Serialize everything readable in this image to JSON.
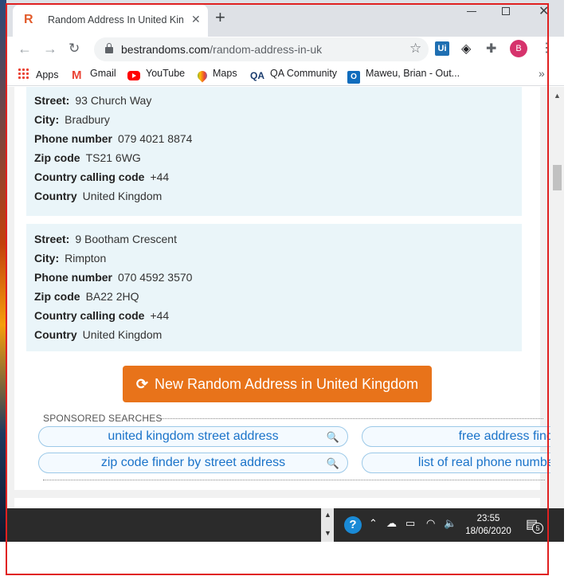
{
  "tab": {
    "favicon": "R",
    "title": "Random Address In United Kingdom",
    "close": "✕",
    "new_tab": "+"
  },
  "window_controls": {
    "minimize": "",
    "maximize": "",
    "close": "✕"
  },
  "toolbar": {
    "back": "←",
    "forward": "→",
    "reload": "↻",
    "url_domain": "bestrandoms.com",
    "url_path": "/random-address-in-uk",
    "star": "☆",
    "ext_ui": "Ui",
    "ext_layers": "◈",
    "ext_puzzle": "✚",
    "avatar": "B",
    "menu": "⋮"
  },
  "bookmarks": {
    "items": [
      "Apps",
      "Gmail",
      "YouTube",
      "Maps",
      "QA Community",
      "Maweu, Brian - Out..."
    ],
    "more": "»"
  },
  "addresses": [
    {
      "street_label": "Street:",
      "street": "93 Church Way",
      "city_label": "City:",
      "city": "Bradbury",
      "phone_label": "Phone number",
      "phone": "079 4021 8874",
      "zip_label": "Zip code",
      "zip": "TS21 6WG",
      "calling_label": "Country calling code",
      "calling": "+44",
      "country_label": "Country",
      "country": "United Kingdom"
    },
    {
      "street_label": "Street:",
      "street": "9 Bootham Crescent",
      "city_label": "City:",
      "city": "Rimpton",
      "phone_label": "Phone number",
      "phone": "070 4592 3570",
      "zip_label": "Zip code",
      "zip": "BA22 2HQ",
      "calling_label": "Country calling code",
      "calling": "+44",
      "country_label": "Country",
      "country": "United Kingdom"
    }
  ],
  "cta": {
    "icon": "⟳",
    "label": "New Random Address in United Kingdom"
  },
  "sponsored": {
    "heading": "SPONSORED SEARCHES",
    "items": [
      "united kingdom street address",
      "free address finder",
      "zip code finder by street address",
      "list of real phone numbers"
    ]
  },
  "taskbar": {
    "help": "?",
    "tray_up": "⌃",
    "tray_cloud": "☁",
    "tray_battery": "▭",
    "tray_wifi": "◠",
    "tray_volume": "🔈",
    "time": "23:55",
    "date": "18/06/2020",
    "notif_icon": "▤",
    "notif_count": "5"
  },
  "colors": {
    "accent_orange": "#e8731a",
    "card_bg": "#eaf5f9",
    "link_blue": "#1a73c9",
    "annotation_red": "#e02020"
  }
}
